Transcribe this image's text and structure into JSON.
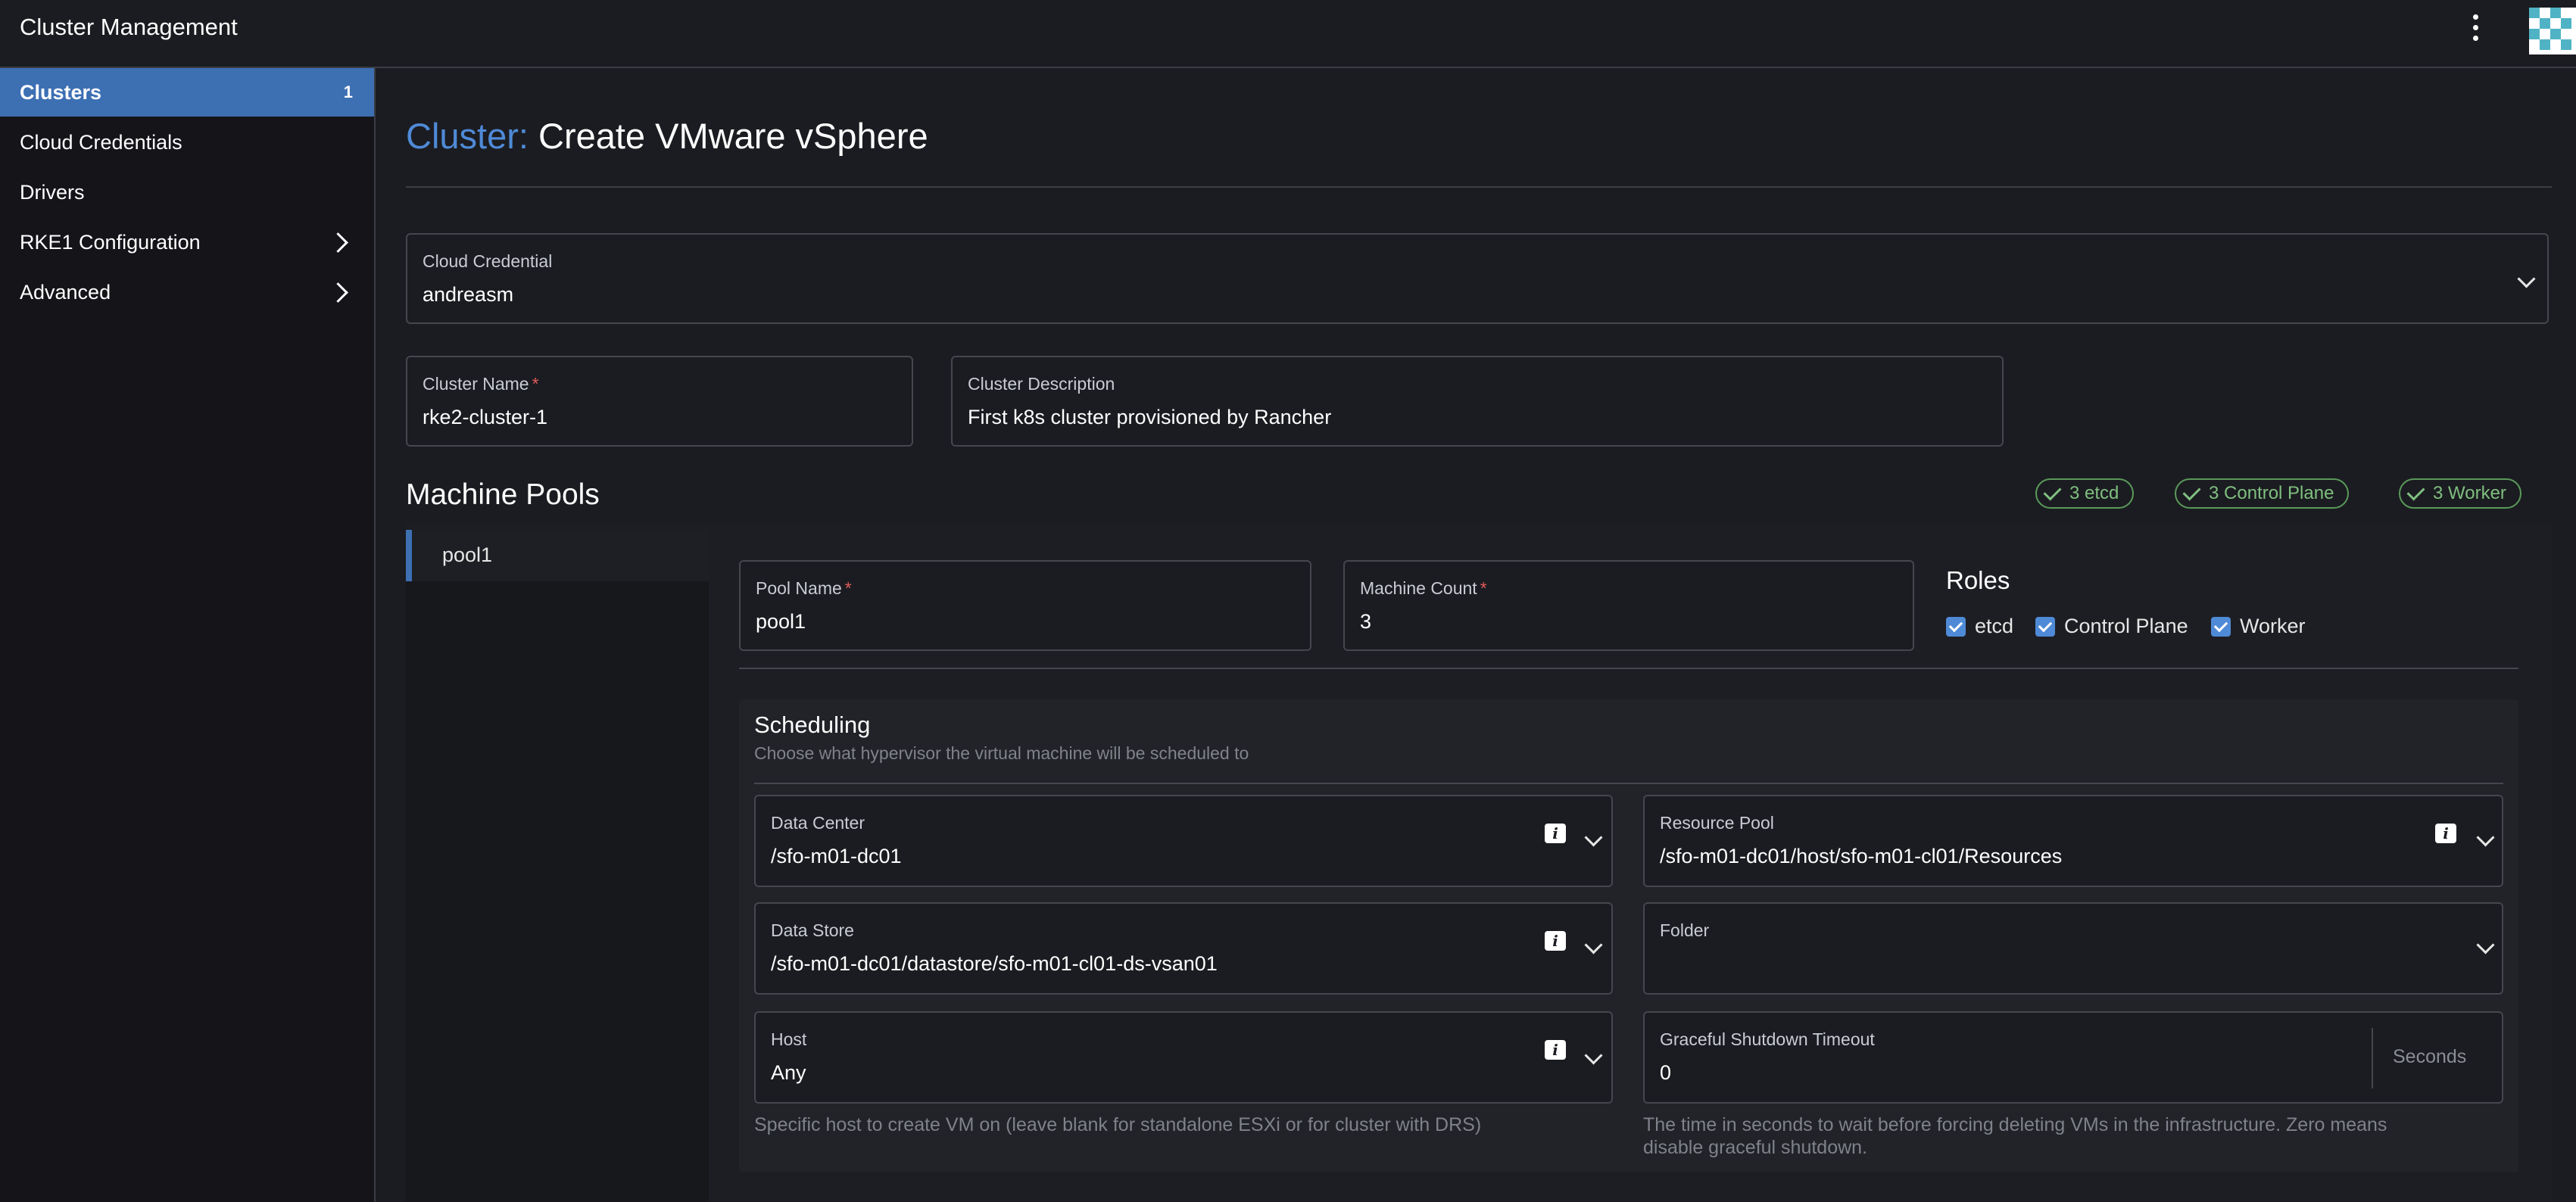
{
  "header": {
    "title": "Cluster Management"
  },
  "sidebar": {
    "items": [
      {
        "label": "Clusters",
        "badge": "1"
      },
      {
        "label": "Cloud Credentials"
      },
      {
        "label": "Drivers"
      },
      {
        "label": "RKE1 Configuration"
      },
      {
        "label": "Advanced"
      }
    ]
  },
  "page": {
    "title_prefix": "Cluster:",
    "title": "Create VMware vSphere"
  },
  "cloud_credential": {
    "label": "Cloud Credential",
    "value": "andreasm"
  },
  "cluster_name": {
    "label": "Cluster Name",
    "required": "*",
    "value": "rke2-cluster-1"
  },
  "cluster_description": {
    "label": "Cluster Description",
    "value": "First k8s cluster provisioned by Rancher"
  },
  "machine_pools": {
    "title": "Machine Pools",
    "summary": [
      "3 etcd",
      "3 Control Plane",
      "3 Worker"
    ],
    "tabs": [
      "pool1"
    ]
  },
  "pool": {
    "pool_name": {
      "label": "Pool Name",
      "required": "*",
      "value": "pool1"
    },
    "machine_count": {
      "label": "Machine Count",
      "required": "*",
      "value": "3"
    },
    "roles": {
      "title": "Roles",
      "items": [
        "etcd",
        "Control Plane",
        "Worker"
      ]
    }
  },
  "scheduling": {
    "title": "Scheduling",
    "subtitle": "Choose what hypervisor the virtual machine will be scheduled to",
    "data_center": {
      "label": "Data Center",
      "value": "/sfo-m01-dc01"
    },
    "resource_pool": {
      "label": "Resource Pool",
      "value": "/sfo-m01-dc01/host/sfo-m01-cl01/Resources"
    },
    "data_store": {
      "label": "Data Store",
      "value": "/sfo-m01-dc01/datastore/sfo-m01-cl01-ds-vsan01"
    },
    "folder": {
      "label": "Folder",
      "value": ""
    },
    "host": {
      "label": "Host",
      "value": "Any",
      "help": "Specific host to create VM on (leave blank for standalone ESXi or for cluster with DRS)"
    },
    "graceful_shutdown": {
      "label": "Graceful Shutdown Timeout",
      "value": "0",
      "suffix": "Seconds",
      "help_line1": "The time in seconds to wait before forcing deleting VMs in the infrastructure. Zero means",
      "help_line2": "disable graceful shutdown."
    }
  },
  "colors": {
    "accent": "#3d6fb3",
    "title_prefix": "#4f8ad6",
    "success": "#7fbf7f",
    "required": "#e05a5a"
  }
}
